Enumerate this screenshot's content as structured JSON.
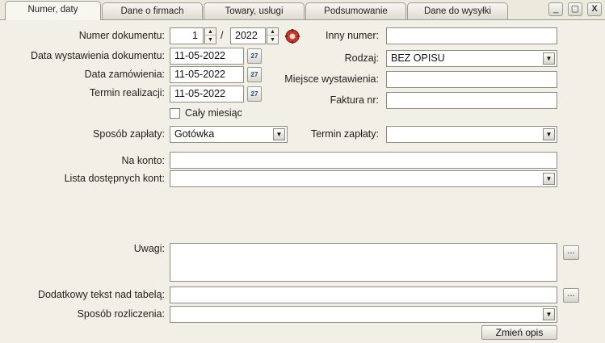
{
  "tabs": [
    {
      "label": "Numer, daty"
    },
    {
      "label": "Dane o firmach"
    },
    {
      "label": "Towary, usługi"
    },
    {
      "label": "Podsumowanie"
    },
    {
      "label": "Dane do wysyłki"
    }
  ],
  "window": {
    "minimize": "_",
    "maximize": "▢",
    "close": "X"
  },
  "form": {
    "numer_dokumentu": {
      "label": "Numer dokumentu:",
      "number": "1",
      "separator": "/",
      "year": "2022"
    },
    "data_wystawienia": {
      "label": "Data wystawienia dokumentu:",
      "value": "11-05-2022"
    },
    "data_zamowienia": {
      "label": "Data zamówienia:",
      "value": "11-05-2022"
    },
    "termin_realizacji": {
      "label": "Termin realizacji:",
      "value": "11-05-2022"
    },
    "caly_miesiac": {
      "label": "Cały miesiąc",
      "checked": false
    },
    "inny_numer": {
      "label": "Inny numer:",
      "value": ""
    },
    "rodzaj": {
      "label": "Rodzaj:",
      "value": "BEZ OPISU"
    },
    "miejsce_wystawienia": {
      "label": "Miejsce wystawienia:",
      "value": ""
    },
    "faktura_nr": {
      "label": "Faktura nr:",
      "value": ""
    },
    "sposob_zaplaty": {
      "label": "Sposób zapłaty:",
      "value": "Gotówka"
    },
    "termin_zaplaty": {
      "label": "Termin zapłaty:",
      "value": ""
    },
    "na_konto": {
      "label": "Na konto:",
      "value": ""
    },
    "lista_kont": {
      "label": "Lista dostępnych kont:",
      "value": ""
    },
    "uwagi": {
      "label": "Uwagi:",
      "value": ""
    },
    "dodatkowy_tekst": {
      "label": "Dodatkowy tekst nad tabelą:",
      "value": ""
    },
    "sposob_rozliczenia": {
      "label": "Sposób rozliczenia:",
      "value": ""
    },
    "calendar_icon_text": "27",
    "ellipsis": "...",
    "zmien_opis": "Zmień opis"
  }
}
